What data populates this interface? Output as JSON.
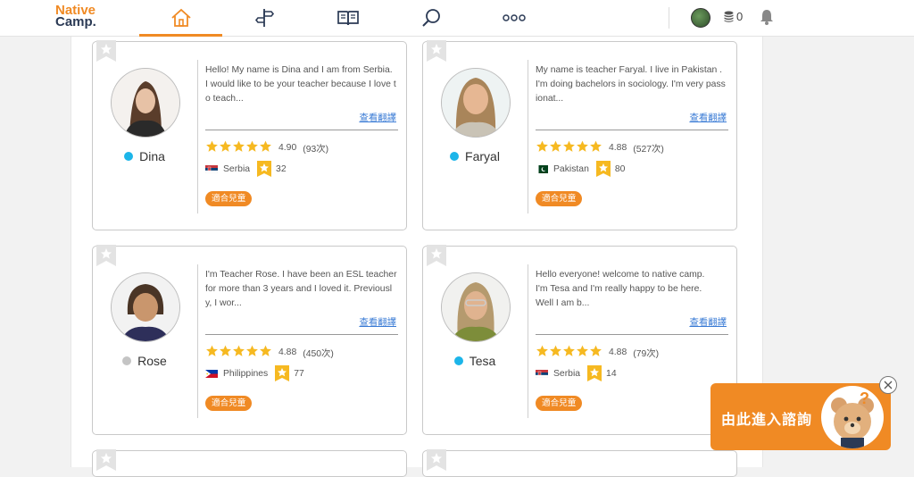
{
  "header": {
    "logo_line1": "Native",
    "logo_line2": "Camp.",
    "coins": "0",
    "nav": [
      "home-icon",
      "signpost-icon",
      "book-icon",
      "search-icon",
      "more-icon"
    ]
  },
  "common": {
    "translate_label": "查看翻譯",
    "kids_label": "適合兒童"
  },
  "colors": {
    "accent": "#f08a24",
    "online": "#1cb5e9",
    "offline": "#c4c4c4",
    "star": "#f6b921",
    "link": "#3a7bd5"
  },
  "teachers": [
    {
      "name": "Dina",
      "status": "online",
      "intro": "Hello! My name is Dina and I am from Serbia. I would like to be your teacher because I love to teach...",
      "rating": 5,
      "score": "4.90",
      "reviews": "(93次)",
      "country": "Serbia",
      "lessons": "32"
    },
    {
      "name": "Faryal",
      "status": "online",
      "intro": "My name is teacher Faryal. I live in Pakistan . I'm doing bachelors in sociology. I'm very passionat...",
      "rating": 5,
      "score": "4.88",
      "reviews": "(527次)",
      "country": "Pakistan",
      "lessons": "80"
    },
    {
      "name": "Rose",
      "status": "offline",
      "intro": "I'm Teacher Rose. I have been an ESL teacher for more than 3 years and I loved it. Previously, I wor...",
      "rating": 5,
      "score": "4.88",
      "reviews": "(450次)",
      "country": "Philippines",
      "lessons": "77"
    },
    {
      "name": "Tesa",
      "status": "online",
      "intro": "Hello everyone! welcome to native camp.\nI'm Tesa and I'm really happy to be here.\nWell I am b...",
      "rating": 5,
      "score": "4.88",
      "reviews": "(79次)",
      "country": "Serbia",
      "lessons": "14"
    }
  ],
  "chat": {
    "label": "由此進入諮詢"
  }
}
